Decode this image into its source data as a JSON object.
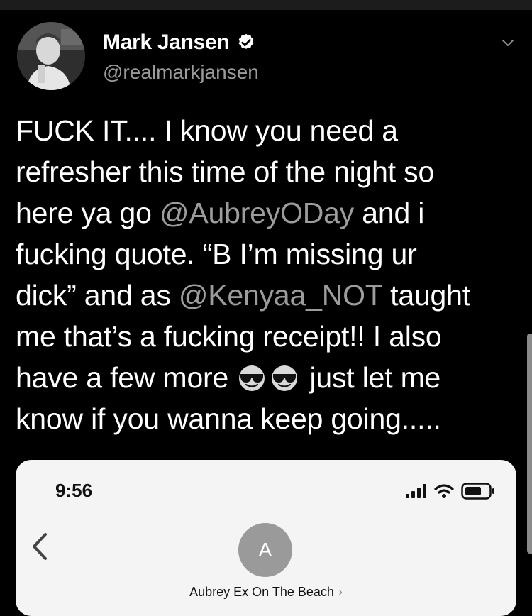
{
  "tweet": {
    "author": {
      "display_name": "Mark Jansen",
      "handle": "@realmarkjansen",
      "verified": true,
      "avatar_icon": "profile-photo",
      "verified_icon": "verified-badge-icon"
    },
    "menu_icon": "chevron-down-icon",
    "text_lines": {
      "l1": "FUCK IT.... I know you need a",
      "l2": "refresher this time of the night so",
      "l3_pre": "here ya go ",
      "l3_mention": "@AubreyODay",
      "l3_post": " and i",
      "l4": "fucking quote. “B I’m missing ur",
      "l5_pre": "dick” and as ",
      "l5_mention": "@Kenyaa_NOT",
      "l5_post": " taught",
      "l6": "me that’s a fucking receipt!! I also",
      "l7_pre": "have a few more ",
      "l7_post": " just let me",
      "l8": "know if you wanna keep going....."
    },
    "emojis": [
      "smiling-face-with-sunglasses",
      "smiling-face-with-sunglasses"
    ]
  },
  "media": {
    "status_bar": {
      "time": "9:56",
      "icons": [
        "cellular-signal-icon",
        "wifi-icon",
        "battery-icon"
      ]
    },
    "back_icon": "back-chevron-icon",
    "contact": {
      "initial": "A",
      "name": "Aubrey Ex On The Beach",
      "arrow": "›"
    }
  },
  "colors": {
    "background": "#000000",
    "text": "#ffffff",
    "mention": "#9c9c9c",
    "handle": "#9b9b9b",
    "card_background": "#f4f4f4",
    "contact_avatar": "#9a9a9a"
  }
}
